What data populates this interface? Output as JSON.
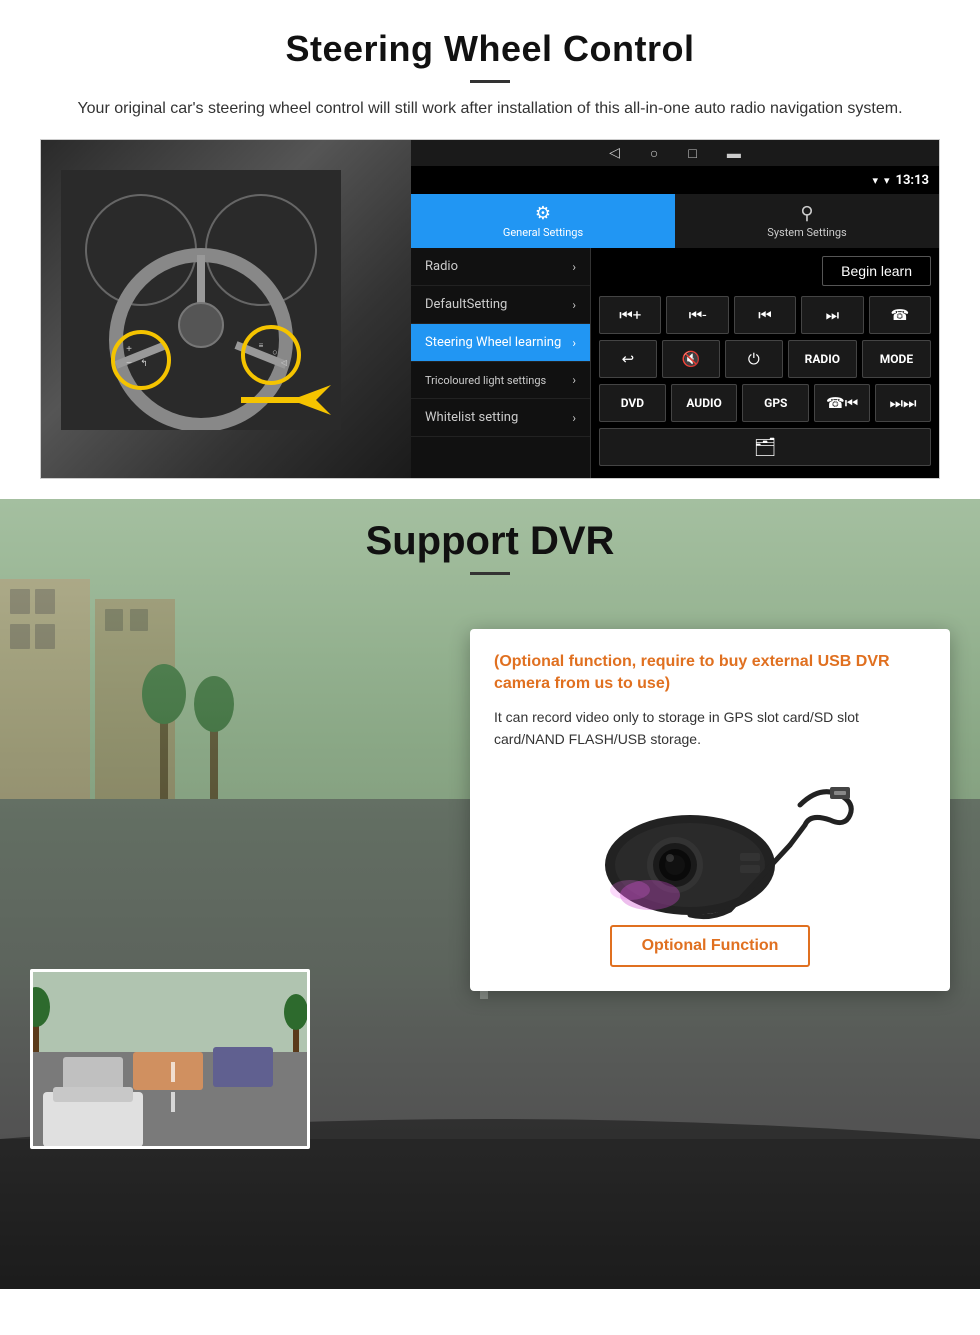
{
  "steering": {
    "title": "Steering Wheel Control",
    "subtitle": "Your original car's steering wheel control will still work after installation of this all-in-one auto radio navigation system.",
    "android": {
      "statusbar": {
        "time": "13:13",
        "wifi_icon": "▾",
        "signal_icon": "▾"
      },
      "navbar": {
        "back": "◁",
        "home": "○",
        "recents": "□",
        "menu": "▬"
      },
      "tabs": [
        {
          "label": "General Settings",
          "active": true
        },
        {
          "label": "System Settings",
          "active": false
        }
      ],
      "menu_items": [
        {
          "label": "Radio",
          "active": false
        },
        {
          "label": "DefaultSetting",
          "active": false
        },
        {
          "label": "Steering Wheel learning",
          "active": true
        },
        {
          "label": "Tricoloured light settings",
          "active": false
        },
        {
          "label": "Whitelist setting",
          "active": false
        }
      ],
      "begin_learn": "Begin learn",
      "control_rows": [
        [
          "⏮+",
          "⏮-",
          "⏮",
          "⏭",
          "☎"
        ],
        [
          "↩",
          "🔇×",
          "⏻",
          "RADIO",
          "MODE"
        ],
        [
          "DVD",
          "AUDIO",
          "GPS",
          "☎⏮",
          "⏭⏭"
        ]
      ]
    }
  },
  "dvr": {
    "title": "Support DVR",
    "optional_text": "(Optional function, require to buy external USB DVR camera from us to use)",
    "description": "It can record video only to storage in GPS slot card/SD slot card/NAND FLASH/USB storage.",
    "optional_button": "Optional Function"
  }
}
